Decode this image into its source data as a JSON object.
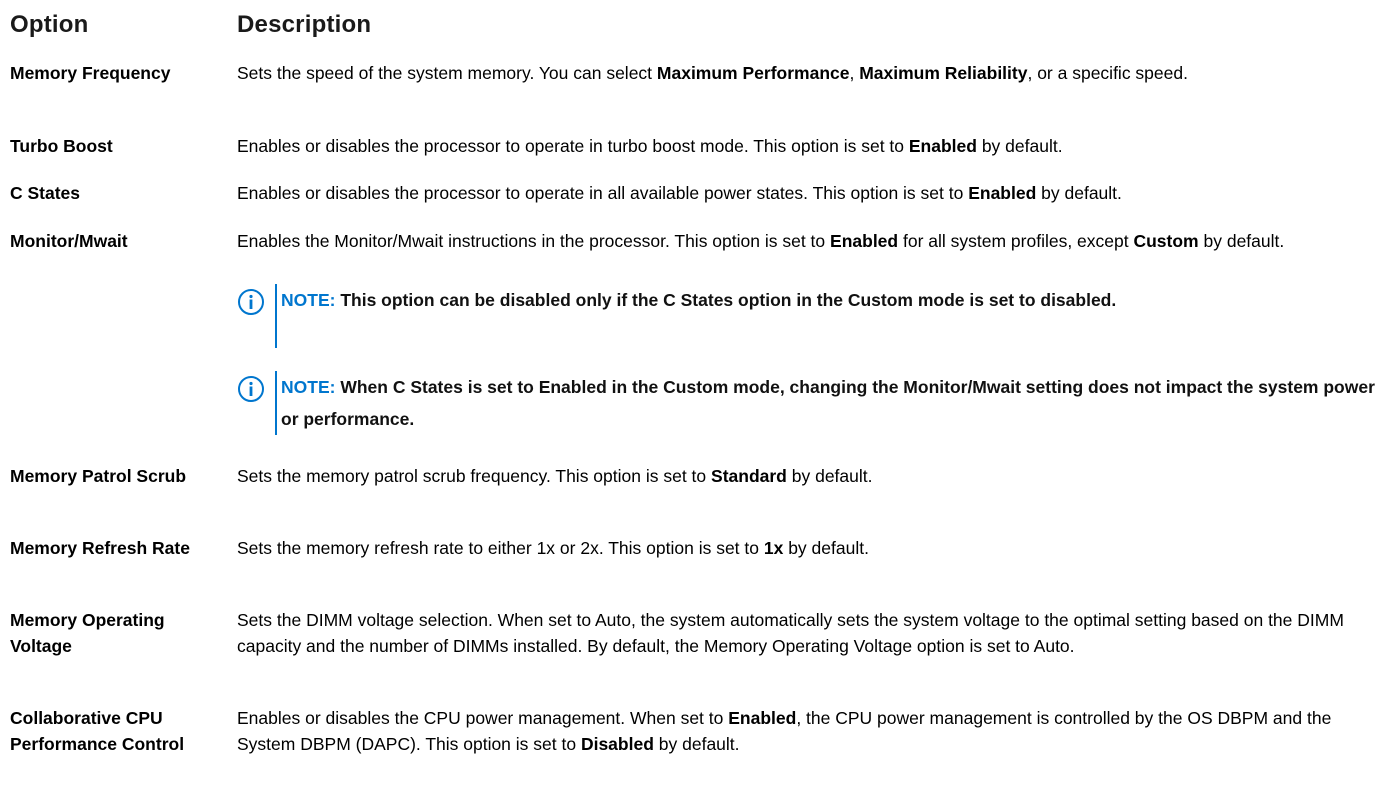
{
  "header": {
    "option": "Option",
    "description": "Description"
  },
  "rows": [
    {
      "option": "Memory Frequency",
      "desc": [
        {
          "t": "Sets the speed of the system memory. You can select "
        },
        {
          "t": "Maximum Performance",
          "b": true
        },
        {
          "t": ", "
        },
        {
          "t": "Maximum Reliability",
          "b": true
        },
        {
          "t": ", or a specific speed."
        }
      ]
    },
    {
      "option": "Turbo Boost",
      "desc": [
        {
          "t": "Enables or disables the processor to operate in turbo boost mode. This option is set to "
        },
        {
          "t": "Enabled",
          "b": true
        },
        {
          "t": " by default."
        }
      ]
    },
    {
      "option": "C States",
      "desc": [
        {
          "t": "Enables or disables the processor to operate in all available power states. This option is set to "
        },
        {
          "t": "Enabled",
          "b": true
        },
        {
          "t": " by default."
        }
      ]
    },
    {
      "option": "Monitor/Mwait",
      "desc": [
        {
          "t": "Enables the Monitor/Mwait instructions in the processor. This option is set to "
        },
        {
          "t": "Enabled",
          "b": true
        },
        {
          "t": " for all system profiles, except "
        },
        {
          "t": "Custom",
          "b": true
        },
        {
          "t": " by default."
        }
      ]
    },
    {
      "option": "Memory Patrol Scrub",
      "desc": [
        {
          "t": "Sets the memory patrol scrub frequency. This option is set to "
        },
        {
          "t": "Standard",
          "b": true
        },
        {
          "t": " by default."
        }
      ]
    },
    {
      "option": "Memory Refresh Rate",
      "desc": [
        {
          "t": "Sets the memory refresh rate to either 1x or 2x. This option is set to "
        },
        {
          "t": "1x",
          "b": true
        },
        {
          "t": " by default."
        }
      ]
    },
    {
      "option": "Memory Operating Voltage",
      "desc": [
        {
          "t": "Sets the DIMM voltage selection. When set to Auto, the system automatically sets the system voltage to the optimal setting based on the DIMM capacity and the number of DIMMs installed. By default, the Memory Operating Voltage option is set to Auto."
        }
      ]
    },
    {
      "option": "Collaborative CPU Performance Control",
      "desc": [
        {
          "t": "Enables or disables the CPU power management. When set to "
        },
        {
          "t": "Enabled",
          "b": true
        },
        {
          "t": ", the CPU power management is controlled by the OS DBPM and the System DBPM (DAPC). This option is set to "
        },
        {
          "t": "Disabled",
          "b": true
        },
        {
          "t": " by default."
        }
      ]
    }
  ],
  "notes": [
    {
      "label": "NOTE:",
      "text": "This option can be disabled only if the C States option in the Custom mode is set to disabled."
    },
    {
      "label": "NOTE:",
      "text": "When C States is set to Enabled in the Custom mode, changing the Monitor/Mwait setting does not impact the system power or performance."
    }
  ],
  "colors": {
    "note_accent": "#0076ce"
  },
  "icons": {
    "note": "info-circle-icon"
  }
}
